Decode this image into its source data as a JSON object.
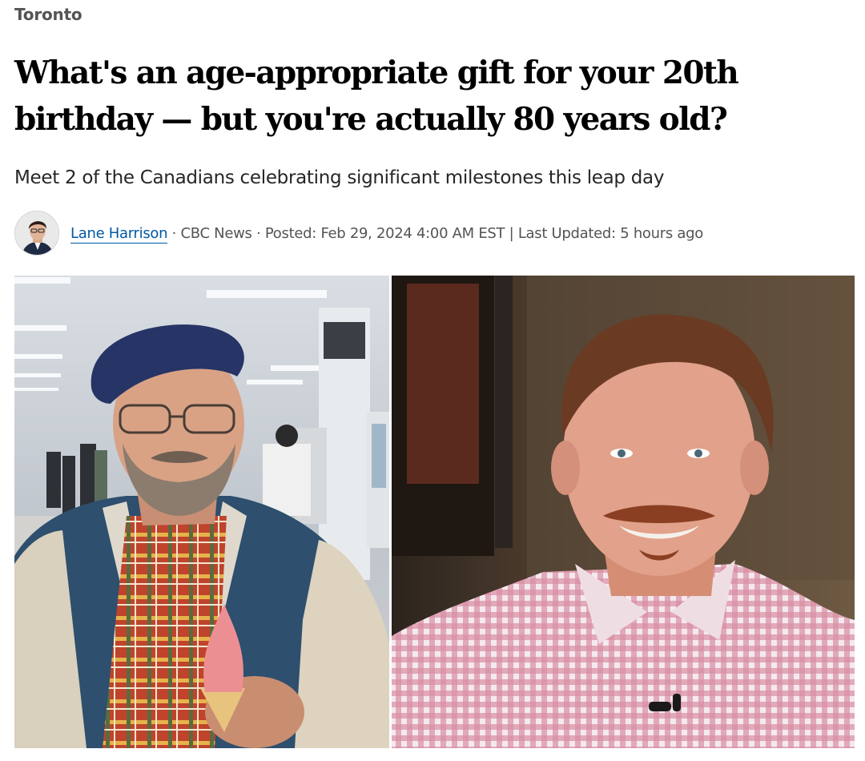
{
  "section": "Toronto",
  "headline": "What's an age-appropriate gift for your 20th birthday — but you're actually 80 years old?",
  "deck": "Meet 2 of the Canadians celebrating significant milestones this leap day",
  "byline": {
    "author": "Lane Harrison",
    "separator": "·",
    "source": "CBC News",
    "posted": "Posted: Feb 29, 2024 4:00 AM EST",
    "divider": "|",
    "updated": "Last Updated: 5 hours ago"
  },
  "avatar_icon": "author-photo",
  "photo_icons": {
    "left": "older-man-with-ice-cream-photo",
    "right": "man-in-checkered-shirt-photo"
  },
  "colors": {
    "link": "#0059a5",
    "meta_text": "#545454",
    "headline": "#000000"
  }
}
